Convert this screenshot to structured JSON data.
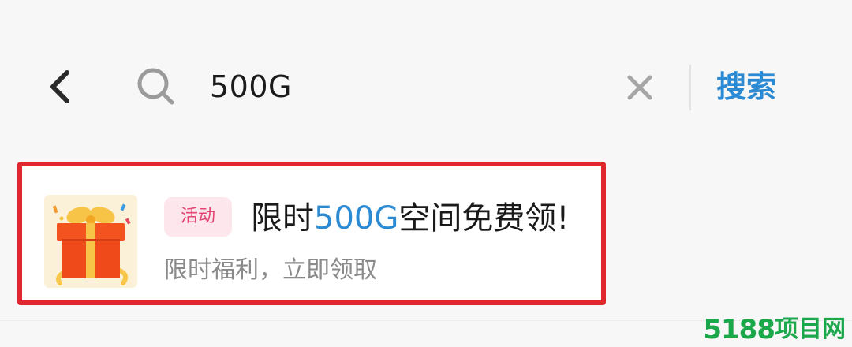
{
  "search": {
    "value": "500G",
    "submit_label": "搜索"
  },
  "icons": {
    "back": "chevron-left-icon",
    "search": "search-icon",
    "clear": "close-icon",
    "gift": "gift-icon"
  },
  "result": {
    "tag_label": "活动",
    "title_prefix": "限时",
    "title_highlight": "500G",
    "title_suffix": "空间免费领!",
    "subtitle": "限时福利，立即领取"
  },
  "watermark": {
    "number": "5188",
    "text": "项目网"
  },
  "colors": {
    "accent_blue": "#2b8ad4",
    "highlight_border": "#e2262d",
    "tag_text": "#e44575",
    "tag_bg": "#fde7ec",
    "watermark_green": "#1aa84b"
  }
}
